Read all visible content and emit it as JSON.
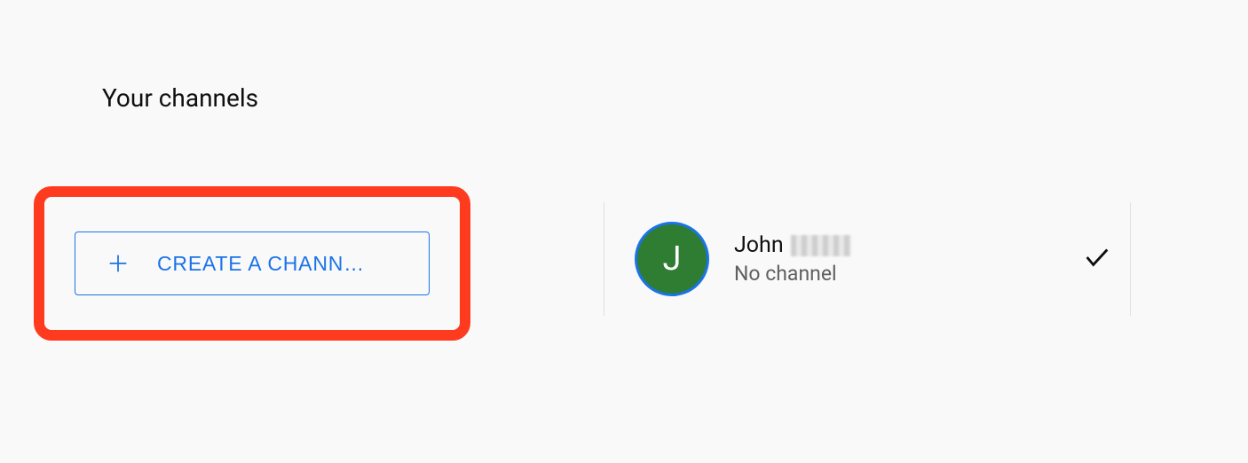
{
  "page": {
    "title": "Your channels"
  },
  "create": {
    "label": "CREATE A CHANN…"
  },
  "account": {
    "avatar_letter": "J",
    "name_first": "John",
    "subtext": "No channel"
  }
}
